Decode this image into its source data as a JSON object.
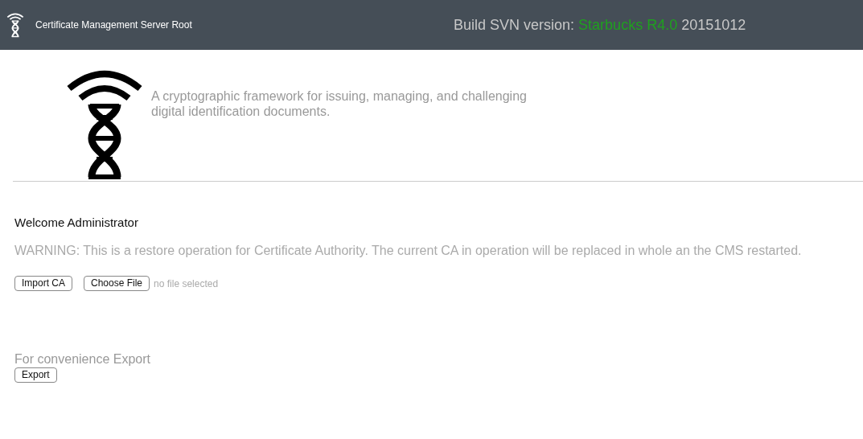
{
  "header": {
    "title": "Certificate Management Server Root",
    "build": {
      "label": "Build SVN version:",
      "codename": "Starbucks R4.0",
      "date": "20151012"
    }
  },
  "intro": {
    "tagline": "A cryptographic framework for issuing, managing, and challenging digital identification documents."
  },
  "welcome": "Welcome Administrator",
  "warning": "WARNING: This is a restore operation for Certificate Authority. The current CA in operation will be replaced in whole an the CMS restarted.",
  "import": {
    "button": "Import CA",
    "file_button": "Choose File",
    "file_status": "no file selected"
  },
  "export": {
    "label": "For convenience Export",
    "button": "Export"
  }
}
